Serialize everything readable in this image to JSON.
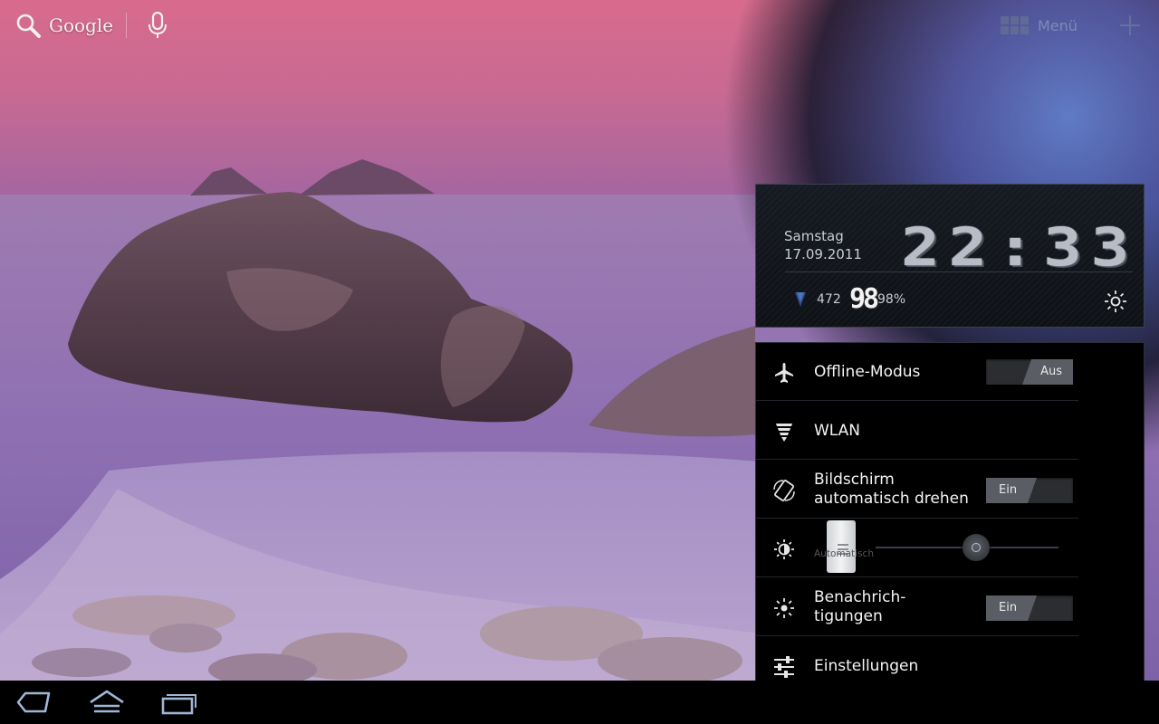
{
  "top_bar": {
    "search_label": "Google",
    "icons": [
      "search-icon",
      "mic-icon",
      "apps-grid-icon",
      "add-icon"
    ],
    "menu_label": "Menü"
  },
  "clock_panel": {
    "day": "Samstag",
    "date": "17.09.2011",
    "time": "22:33",
    "signal_value": "472",
    "battery_big": "98",
    "battery_percent": "98%"
  },
  "quick_settings": {
    "airplane": {
      "label": "Offline-Modus",
      "toggle": "Aus"
    },
    "wifi": {
      "label": "WLAN"
    },
    "autorotate": {
      "label_line1": "Bildschirm",
      "label_line2": "automatisch drehen",
      "toggle": "Ein"
    },
    "brightness": {
      "auto_label": "Automatisch",
      "level": 0.55
    },
    "notifications": {
      "label_line1": "Benachrich-",
      "label_line2": "tigungen",
      "toggle": "Ein"
    },
    "settings": {
      "label": "Einstellungen"
    }
  },
  "navbar": {
    "icons": [
      "back-icon",
      "home-icon",
      "recent-apps-icon"
    ]
  },
  "colors": {
    "accent": "#5e7fb8",
    "panel_bg": "#0e1116",
    "toggle_knob": "#5a5d63"
  }
}
